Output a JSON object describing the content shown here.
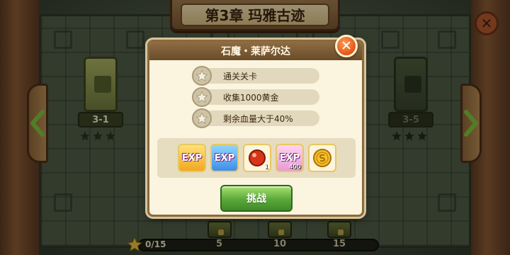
{
  "chapter": {
    "title": "第3章 玛雅古迹"
  },
  "levels": [
    {
      "label": "3-1",
      "stars_earned": 0,
      "stars_total": 3
    },
    {
      "label": "3-5",
      "stars_earned": 0,
      "stars_total": 3
    }
  ],
  "progress": {
    "text": "0/15",
    "earned": 0,
    "total": 15,
    "milestones": [
      {
        "label": "5"
      },
      {
        "label": "10"
      },
      {
        "label": "15"
      }
    ]
  },
  "dialog": {
    "title": "石魔・莱萨尔达",
    "close_icon": "close-icon",
    "objectives": [
      {
        "text": "通关关卡",
        "icon": "star-icon"
      },
      {
        "text": "收集1000黄金",
        "icon": "star-icon"
      },
      {
        "text": "剩余血量大于40%",
        "icon": "star-icon"
      }
    ],
    "rewards": [
      {
        "type": "exp-yellow",
        "label": "EXP",
        "quantity": ""
      },
      {
        "type": "exp-blue",
        "label": "EXP",
        "quantity": ""
      },
      {
        "type": "red-orb",
        "label": "",
        "quantity": "1"
      },
      {
        "type": "exp-pink",
        "label": "EXP",
        "quantity": "400"
      },
      {
        "type": "gold-coin",
        "label": "",
        "quantity": ""
      }
    ],
    "challenge_label": "挑战"
  },
  "colors": {
    "accent_green": "#5aa83a",
    "close_orange": "#e2561a",
    "panel_bg": "#fbf4de"
  }
}
